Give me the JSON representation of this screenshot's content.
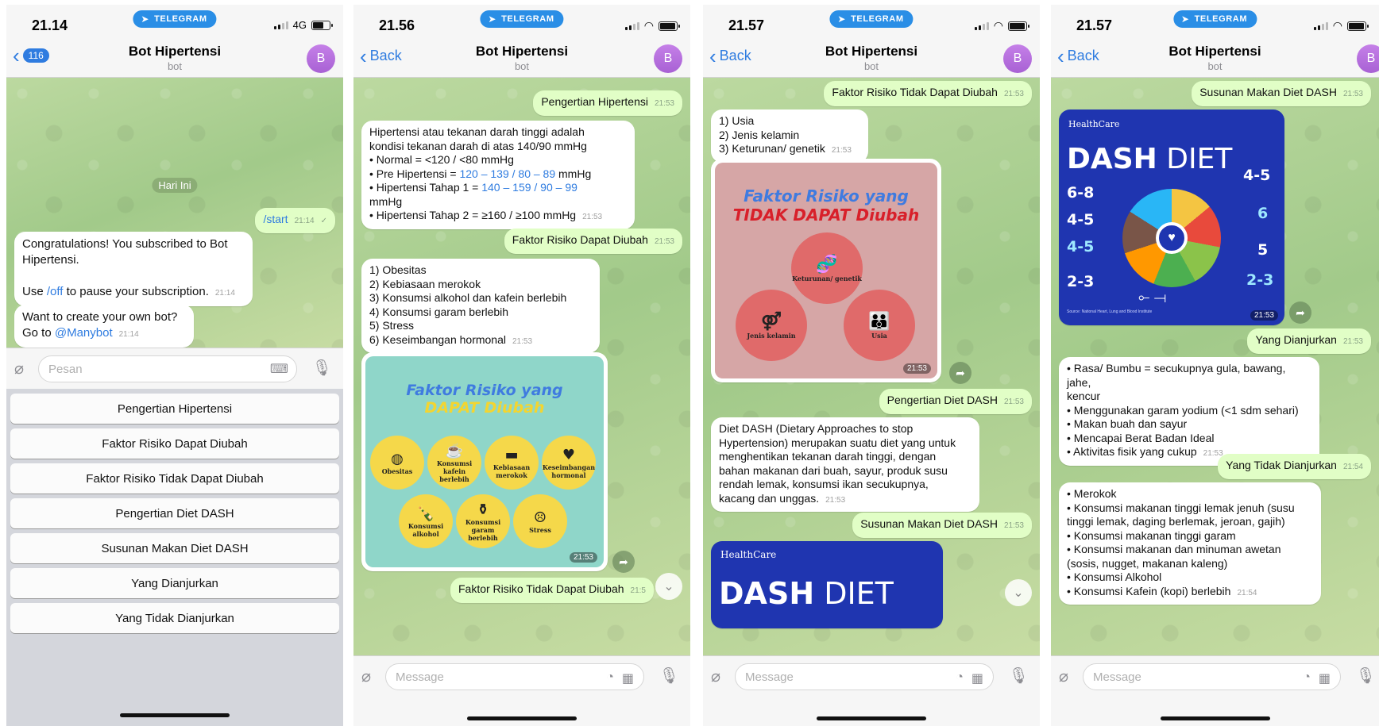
{
  "common": {
    "bot_name": "Bot Hipertensi",
    "bot_sub": "bot",
    "avatar_letter": "B",
    "telegram_label": "TELEGRAM",
    "back_label": "Back",
    "message_placeholder": "Message",
    "forward_glyph": "➦"
  },
  "screens": [
    {
      "time": "21.14",
      "network": "4G",
      "back_badge": "116",
      "date_label": "Hari Ini",
      "start_cmd": "/start",
      "start_time": "21:14",
      "welcome_line1": "Congratulations! You subscribed to Bot Hipertensi.",
      "welcome_pre": "Use ",
      "welcome_link": "/off",
      "welcome_post": " to pause your subscription.",
      "welcome_time": "21:14",
      "manybot_line1": "Want to create your own bot?",
      "manybot_pre": "Go to ",
      "manybot_link": "@Manybot",
      "manybot_time": "21:14",
      "input_placeholder": "Pesan",
      "keyboard": [
        "Pengertian Hipertensi",
        "Faktor Risiko Dapat Diubah",
        "Faktor Risiko Tidak Dapat Diubah",
        "Pengertian Diet DASH",
        "Susunan Makan Diet DASH",
        "Yang Dianjurkan",
        "Yang Tidak Dianjurkan"
      ]
    },
    {
      "time": "21.56",
      "q1": "Pengertian Hipertensi",
      "q1_time": "21:53",
      "def_l1": "Hipertensi atau tekanan darah tinggi adalah",
      "def_l2": "kondisi tekanan darah di atas 140/90 mmHg",
      "def_l3": "• Normal = <120 / <80 mmHg",
      "def_l4_pre": "• Pre Hipertensi = ",
      "def_l4_link": "120 – 139 / 80 – 89",
      "def_l4_post": " mmHg",
      "def_l5_pre": "• Hipertensi Tahap 1 = ",
      "def_l5_link": "140 – 159 / 90 – 99",
      "def_l6": "mmHg",
      "def_l7": "• Hipertensi Tahap 2 = ≥160 / ≥100 mmHg",
      "def_time": "21:53",
      "q2": "Faktor Risiko Dapat Diubah",
      "q2_time": "21:53",
      "risk_list": "1) Obesitas\n2) Kebiasaan merokok\n3) Konsumsi alkohol dan kafein berlebih\n4) Konsumsi garam berlebih\n5) Stress\n6) Keseimbangan hormonal",
      "risk_time": "21:53",
      "poster_title1": "Faktor Risiko yang",
      "poster_title2": "DAPAT Diubah",
      "poster_items": [
        "Obesitas",
        "Konsumsi kafein berlebih",
        "Kebiasaan merokok",
        "Keseimbangan hormonal",
        "Konsumsi alkohol",
        "Konsumsi garam berlebih",
        "Stress"
      ],
      "poster_time": "21:53",
      "q3": "Faktor Risiko Tidak Dapat Diubah",
      "q3_time": "21:5"
    },
    {
      "time": "21.57",
      "q1": "Faktor Risiko Tidak Dapat Diubah",
      "q1_time": "21:53",
      "list": "1) Usia\n2) Jenis kelamin\n3) Keturunan/ genetik",
      "list_time": "21:53",
      "poster_title1": "Faktor Risiko yang",
      "poster_title2": "TIDAK DAPAT Diubah",
      "poster_items": [
        "Keturunan/ genetik",
        "Jenis kelamin",
        "Usia"
      ],
      "poster_time": "21:53",
      "q2": "Pengertian Diet DASH",
      "q2_time": "21:53",
      "dash_def": "Diet DASH (Dietary Approaches to stop\nHypertension) merupakan suatu diet yang untuk\nmenghentikan tekanan darah tinggi, dengan\nbahan makanan dari buah, sayur, produk susu\nrendah lemak, konsumsi ikan secukupnya,\nkacang dan unggas.",
      "dash_time": "21:53",
      "q3": "Susunan Makan Diet DASH",
      "q3_time": "21:53",
      "img_brand": "HealthCare",
      "img_title_a": "DASH",
      "img_title_b": " DIET"
    },
    {
      "time": "21.57",
      "q1": "Susunan Makan Diet DASH",
      "q1_time": "21:53",
      "img_brand": "HealthCare",
      "img_title_a": "DASH",
      "img_title_b": " DIET",
      "img_left": [
        "6-8",
        "4-5",
        "4-5",
        "2-3"
      ],
      "img_right": [
        "4-5",
        "6",
        "5",
        "2-3"
      ],
      "img_source": "Source: National Heart, Lung and Blood Institute",
      "img_time": "21:53",
      "q2": "Yang Dianjurkan",
      "q2_time": "21:53",
      "rec": "• Rasa/ Bumbu = secukupnya gula, bawang, jahe,\nkencur\n• Menggunakan garam yodium (<1 sdm sehari)\n• Makan buah dan sayur\n• Mencapai Berat Badan Ideal\n• Aktivitas fisik yang cukup",
      "rec_time": "21:53",
      "q3": "Yang Tidak Dianjurkan",
      "q3_time": "21:54",
      "notrec": "• Merokok\n• Konsumsi makanan tinggi lemak jenuh (susu\ntinggi lemak, daging berlemak, jeroan, gajih)\n• Konsumsi makanan tinggi garam\n• Konsumsi makanan dan minuman awetan\n(sosis, nugget, makanan kaleng)\n• Konsumsi Alkohol\n• Konsumsi Kafein (kopi) berlebih",
      "notrec_time": "21:54"
    }
  ]
}
